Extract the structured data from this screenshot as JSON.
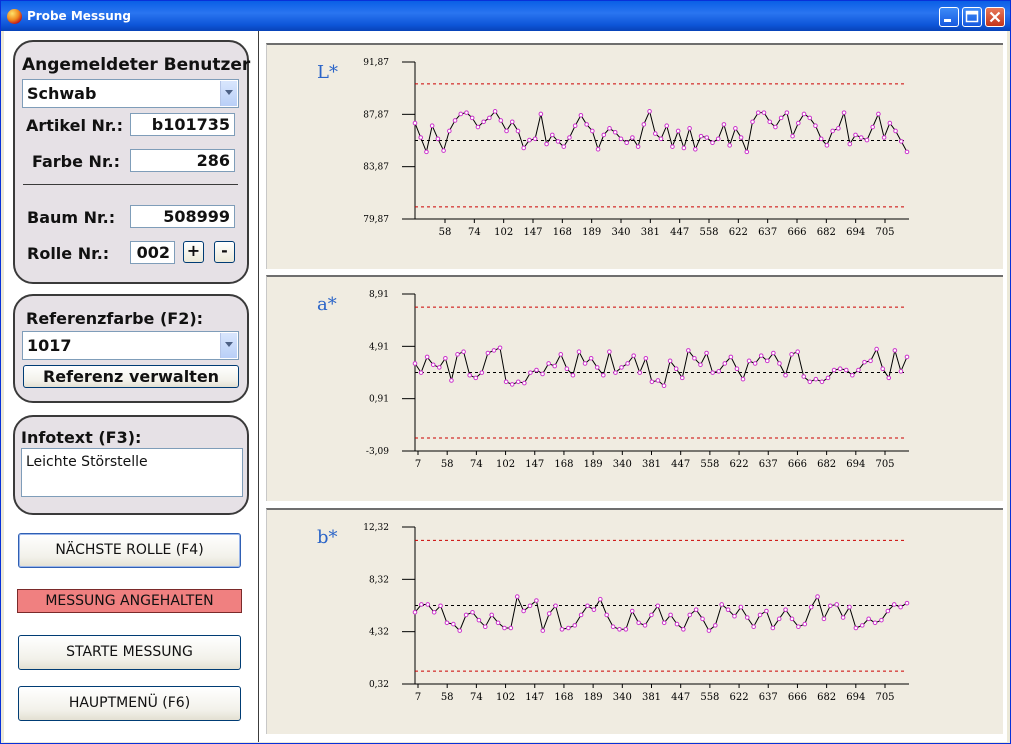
{
  "window": {
    "title": "Probe Messung"
  },
  "user_group": {
    "heading": "Angemeldeter Benutzer",
    "user_value": "Schwab",
    "artikel_label": "Artikel Nr.:",
    "artikel_value": "b101735",
    "farbe_label": "Farbe Nr.:",
    "farbe_value": "286",
    "baum_label": "Baum Nr.:",
    "baum_value": "508999",
    "rolle_label": "Rolle Nr.:",
    "rolle_value": "002",
    "plus_label": "+",
    "minus_label": "-"
  },
  "reference_group": {
    "heading": "Referenzfarbe (F2):",
    "value": "1017",
    "manage_label": "Referenz verwalten"
  },
  "info_group": {
    "heading": "Infotext (F3):",
    "text": "Leichte Störstelle"
  },
  "buttons": {
    "next_roll": "NÄCHSTE ROLLE (F4)",
    "status": "MESSUNG ANGEHALTEN",
    "start": "STARTE MESSUNG",
    "main_menu": "HAUPTMENÜ (F6)"
  },
  "colors": {
    "series_line": "#000000",
    "series_point": "#cc33cc",
    "limit_line": "#cc0000",
    "mean_line": "#000000",
    "label_blue": "#2a64c8",
    "status_bg": "#f08080"
  },
  "chart_data": [
    {
      "type": "line",
      "title": "L*",
      "ylim": [
        79.87,
        91.87
      ],
      "ytick_labels": [
        "91,87",
        "87,87",
        "83,87",
        "79,87"
      ],
      "ytick_values": [
        91.87,
        87.87,
        83.87,
        79.87
      ],
      "categories": [
        "58",
        "74",
        "102",
        "147",
        "168",
        "189",
        "340",
        "381",
        "447",
        "558",
        "622",
        "637",
        "666",
        "682",
        "694",
        "705"
      ],
      "upper_limit": 90.2,
      "lower_limit": 80.8,
      "mean": 85.87,
      "values": [
        87.2,
        86.1,
        85.0,
        87.0,
        86.0,
        85.1,
        86.6,
        87.4,
        87.9,
        88.0,
        87.6,
        86.9,
        87.3,
        87.6,
        88.1,
        87.4,
        86.6,
        87.3,
        86.6,
        85.3,
        85.9,
        86.0,
        87.9,
        85.6,
        86.3,
        85.8,
        85.4,
        86.1,
        87.0,
        87.8,
        87.1,
        86.6,
        85.2,
        86.3,
        86.8,
        86.5,
        86.0,
        85.7,
        86.1,
        85.4,
        87.1,
        88.1,
        86.4,
        86.0,
        87.0,
        85.4,
        86.6,
        85.3,
        86.8,
        85.2,
        86.2,
        86.1,
        85.7,
        86.0,
        87.1,
        85.5,
        86.8,
        86.1,
        85.0,
        87.3,
        88.0,
        88.0,
        87.3,
        86.9,
        87.6,
        88.0,
        86.2,
        87.2,
        87.9,
        87.6,
        87.0,
        86.0,
        85.5,
        86.6,
        86.8,
        88.0,
        85.6,
        86.3,
        86.1,
        85.9,
        86.9,
        87.9,
        86.1,
        87.2,
        86.6,
        85.8,
        85.0
      ]
    },
    {
      "type": "line",
      "title": "a*",
      "ylim": [
        -3.09,
        8.91
      ],
      "ytick_labels": [
        "8,91",
        "4,91",
        "0,91",
        "-3,09"
      ],
      "ytick_values": [
        8.91,
        4.91,
        0.91,
        -3.09
      ],
      "categories": [
        "7",
        "58",
        "74",
        "102",
        "147",
        "168",
        "189",
        "340",
        "381",
        "447",
        "558",
        "622",
        "637",
        "666",
        "682",
        "694",
        "705"
      ],
      "upper_limit": 7.91,
      "lower_limit": -2.1,
      "mean": 2.91,
      "values": [
        3.6,
        2.9,
        4.1,
        3.5,
        3.3,
        4.0,
        2.3,
        4.3,
        4.5,
        2.7,
        2.5,
        2.9,
        4.4,
        4.6,
        4.8,
        2.2,
        2.0,
        2.2,
        2.1,
        2.9,
        3.1,
        2.8,
        3.6,
        3.4,
        4.3,
        3.2,
        2.7,
        4.5,
        3.6,
        4.0,
        3.3,
        2.7,
        4.5,
        2.9,
        3.3,
        3.6,
        4.2,
        2.9,
        4.0,
        2.2,
        2.3,
        1.9,
        3.8,
        3.2,
        2.5,
        4.6,
        4.0,
        3.5,
        4.4,
        2.9,
        3.0,
        3.6,
        4.1,
        3.2,
        2.4,
        3.8,
        3.6,
        4.2,
        3.8,
        4.4,
        3.6,
        2.7,
        4.3,
        4.5,
        2.6,
        2.2,
        2.4,
        2.2,
        2.5,
        3.1,
        3.2,
        3.1,
        2.7,
        3.1,
        3.7,
        3.8,
        4.7,
        3.2,
        2.5,
        4.6,
        3.0,
        4.1
      ]
    },
    {
      "type": "line",
      "title": "b*",
      "ylim": [
        0.32,
        12.32
      ],
      "ytick_labels": [
        "12,32",
        "8,32",
        "4,32",
        "0,32"
      ],
      "ytick_values": [
        12.32,
        8.32,
        4.32,
        0.32
      ],
      "categories": [
        "7",
        "58",
        "74",
        "102",
        "147",
        "168",
        "189",
        "340",
        "381",
        "447",
        "558",
        "622",
        "637",
        "666",
        "682",
        "694",
        "705"
      ],
      "upper_limit": 11.3,
      "lower_limit": 1.3,
      "mean": 6.32,
      "values": [
        5.8,
        6.4,
        6.4,
        5.8,
        6.3,
        5.0,
        4.9,
        4.4,
        5.6,
        5.8,
        5.2,
        4.7,
        5.6,
        5.0,
        4.6,
        4.6,
        7.0,
        5.9,
        6.3,
        6.7,
        4.4,
        5.7,
        6.3,
        4.5,
        4.6,
        4.8,
        5.6,
        6.3,
        6.0,
        6.8,
        5.6,
        4.7,
        4.5,
        4.5,
        5.9,
        5.0,
        4.8,
        5.6,
        6.3,
        5.0,
        5.6,
        4.9,
        4.5,
        5.6,
        6.0,
        5.3,
        4.4,
        4.8,
        6.4,
        6.0,
        5.5,
        6.2,
        5.4,
        4.7,
        5.6,
        5.9,
        4.6,
        5.3,
        6.0,
        5.3,
        4.7,
        4.9,
        6.2,
        7.0,
        5.3,
        6.3,
        6.4,
        5.4,
        6.2,
        4.6,
        4.8,
        5.3,
        5.0,
        5.2,
        5.9,
        6.4,
        6.2,
        6.5
      ]
    }
  ]
}
